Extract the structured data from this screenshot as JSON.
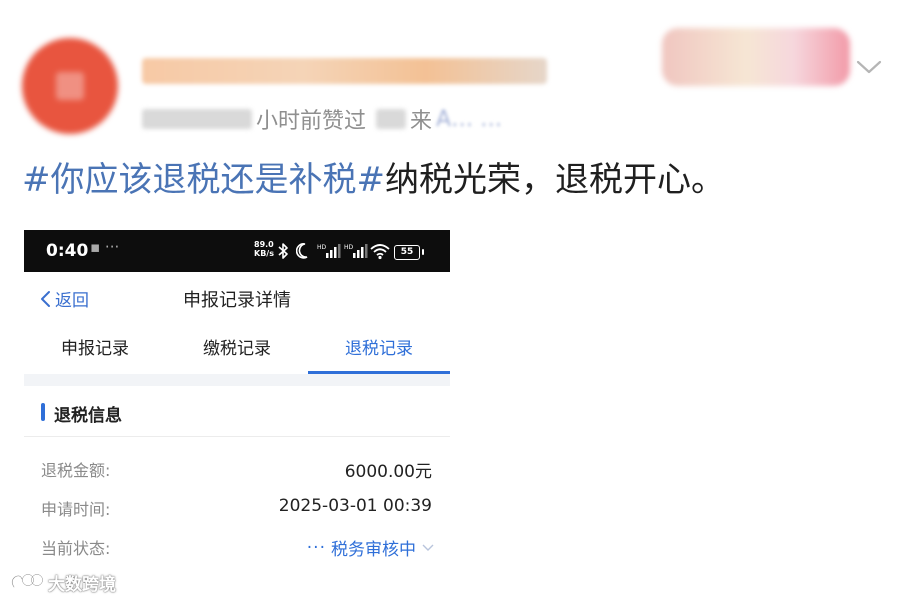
{
  "post": {
    "meta_time": "小时前赞过",
    "meta_from": "来",
    "meta_source": "A… …",
    "text_tag1": "#你应该退税还是补税#",
    "text_body": "纳税光荣，退税开心。"
  },
  "phone": {
    "status_bar": {
      "time": "0:40",
      "dots": "▪ ···",
      "net_speed_value": "89.0",
      "net_speed_unit": "KB/s",
      "battery": "55"
    },
    "nav": {
      "back_label": "返回",
      "title": "申报记录详情"
    },
    "tabs": [
      {
        "label": "申报记录",
        "active": false
      },
      {
        "label": "缴税记录",
        "active": false
      },
      {
        "label": "退税记录",
        "active": true
      }
    ],
    "section_title": "退税信息",
    "rows": [
      {
        "label": "退税金额:",
        "value": "6000.00元"
      },
      {
        "label": "申请时间:",
        "value": "2025-03-01 00:39"
      },
      {
        "label": "当前状态:",
        "value": "税务审核中"
      }
    ],
    "status_dots": "···"
  },
  "watermark": {
    "text": "大数跨境"
  },
  "colors": {
    "accent": "#2f6fd8",
    "hashtag": "#4a74b5",
    "avatar": "#e8553f"
  }
}
